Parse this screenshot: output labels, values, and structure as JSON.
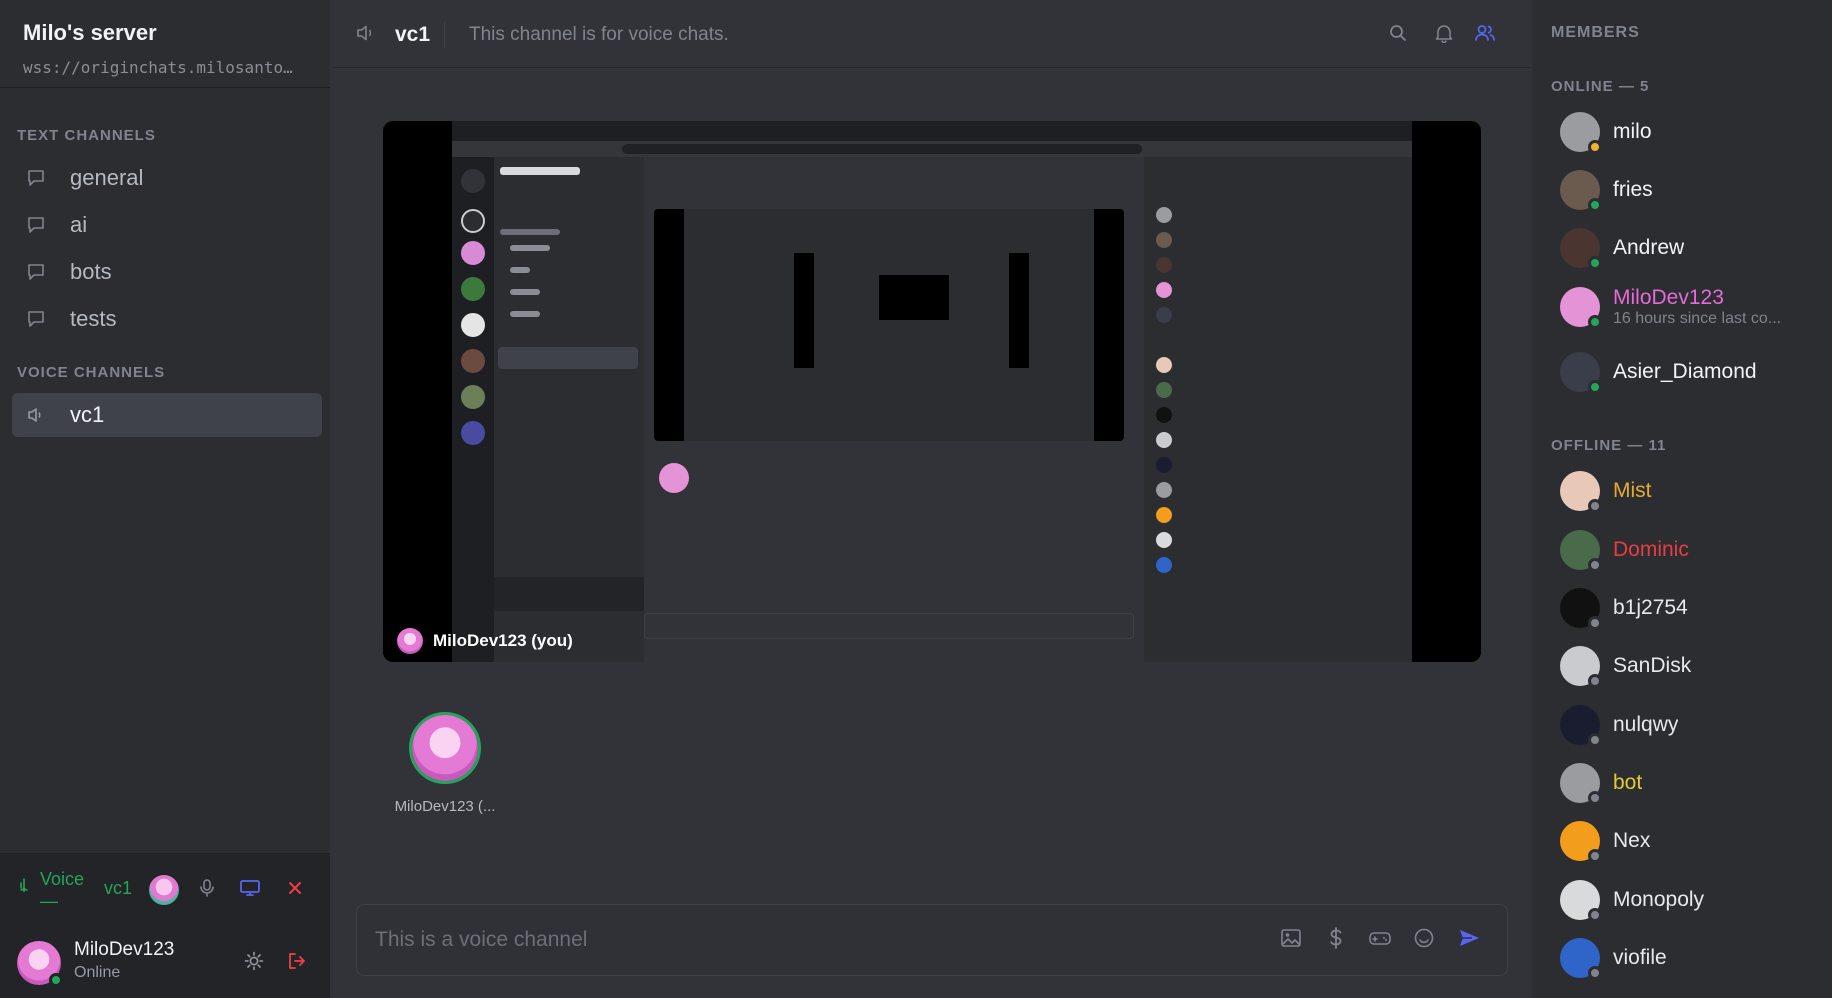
{
  "server": {
    "name": "Milo's server",
    "url": "wss://originchats.milosanto…"
  },
  "sidebar": {
    "text_header": "TEXT CHANNELS",
    "text_channels": [
      {
        "label": "general"
      },
      {
        "label": "ai"
      },
      {
        "label": "bots"
      },
      {
        "label": "tests"
      }
    ],
    "voice_header": "VOICE CHANNELS",
    "voice_channels": [
      {
        "label": "vc1",
        "active": true
      }
    ]
  },
  "voice_bar": {
    "status": "Voice",
    "status_line2": "—",
    "channel": "vc1"
  },
  "user": {
    "name": "MiloDev123",
    "status": "Online"
  },
  "topbar": {
    "channel": "vc1",
    "topic": "This channel is for voice chats."
  },
  "stage": {
    "label": "MiloDev123 (you)"
  },
  "participant": {
    "name": "MiloDev123 (..."
  },
  "composer": {
    "placeholder": "This is a voice channel"
  },
  "members": {
    "title": "MEMBERS",
    "online_title": "ONLINE — 5",
    "offline_title": "OFFLINE — 11",
    "online": [
      {
        "name": "milo",
        "color": "#f2f3f5",
        "status": "idle",
        "avatar": "#9a9ca0"
      },
      {
        "name": "fries",
        "color": "#f2f3f5",
        "status": "online",
        "avatar": "#6b5a4e"
      },
      {
        "name": "Andrew",
        "color": "#f2f3f5",
        "status": "online",
        "avatar": "#4a3530"
      },
      {
        "name": "MiloDev123",
        "sub": "16 hours since last co...",
        "color": "#e66ad9",
        "status": "online",
        "avatar": "#e493d6"
      },
      {
        "name": "Asier_Diamond",
        "color": "#f2f3f5",
        "status": "online",
        "avatar": "#3a3d4a"
      }
    ],
    "offline": [
      {
        "name": "Mist",
        "color": "#f0b232",
        "avatar": "#e8c9b8"
      },
      {
        "name": "Dominic",
        "color": "#f23f42",
        "avatar": "#4a6b4a"
      },
      {
        "name": "b1j2754",
        "color": "#f2f3f5",
        "avatar": "#111111"
      },
      {
        "name": "SanDisk",
        "color": "#f2f3f5",
        "avatar": "#c9cbcf"
      },
      {
        "name": "nulqwy",
        "color": "#f2f3f5",
        "avatar": "#1a1d30"
      },
      {
        "name": "bot",
        "color": "#f0d232",
        "avatar": "#9a9ca0"
      },
      {
        "name": "Nex",
        "color": "#f2f3f5",
        "avatar": "#f29d1b"
      },
      {
        "name": "Monopoly",
        "color": "#f2f3f5",
        "avatar": "#d9dadc"
      },
      {
        "name": "viofile",
        "color": "#f2f3f5",
        "avatar": "#2f64c9"
      }
    ]
  },
  "colors": {
    "accent": "#5865f2",
    "voice_green": "#23a55a",
    "danger": "#f23f42",
    "online": "#23a55a"
  }
}
